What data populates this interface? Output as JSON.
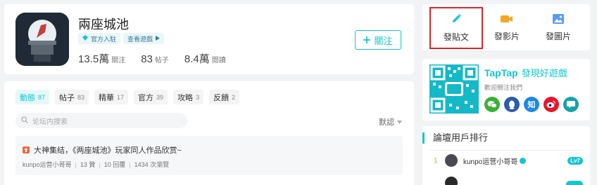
{
  "game": {
    "title": "兩座城池",
    "badge_official": "官方入駐",
    "badge_view_game": "查看遊戲",
    "stats": [
      {
        "num": "13.5萬",
        "label": "關注"
      },
      {
        "num": "83",
        "label": "帖子"
      },
      {
        "num": "8.4萬",
        "label": "閱讀"
      }
    ],
    "follow_label": "關注"
  },
  "tabs": [
    {
      "label": "動態",
      "count": "87"
    },
    {
      "label": "帖子",
      "count": "83"
    },
    {
      "label": "精華",
      "count": "17"
    },
    {
      "label": "官方",
      "count": "39"
    },
    {
      "label": "攻略",
      "count": "3"
    },
    {
      "label": "反饋",
      "count": "2"
    }
  ],
  "search": {
    "placeholder": "论坛内搜索"
  },
  "sort": {
    "label": "默認"
  },
  "post": {
    "title": "大神集结，《两座城池》玩家同人作品欣赏~",
    "author": "kunpo运营小哥哥",
    "likes": "13 贊",
    "replies": "10 回覆",
    "views": "1434 次瀏覽"
  },
  "actions": [
    {
      "label": "發貼文",
      "icon": "pencil-icon"
    },
    {
      "label": "發影片",
      "icon": "video-icon"
    },
    {
      "label": "發圖片",
      "icon": "image-icon"
    }
  ],
  "taptap": {
    "logo": "TapTap",
    "slogan": "發現好遊戲",
    "subtitle": "歡迎關注我們",
    "socials": [
      {
        "name": "wechat-icon",
        "glyph": "",
        "color": "#3cb034"
      },
      {
        "name": "qq-icon",
        "glyph": "",
        "color": "#2a5caa"
      },
      {
        "name": "zhihu-icon",
        "glyph": "知",
        "color": "#1e88e5"
      },
      {
        "name": "weibo-icon",
        "glyph": "",
        "color": "#e6162d"
      },
      {
        "name": "message-icon",
        "glyph": "",
        "color": "#15a3a8"
      }
    ]
  },
  "ranking": {
    "title": "論壇用戶排行",
    "rows": [
      {
        "rank": "1",
        "name": "kunpo运营小哥哥",
        "level": "Lv7"
      }
    ]
  },
  "colors": {
    "accent": "#15c5ce",
    "highlight": "#d9262c",
    "top_tag": "#f0643c"
  }
}
